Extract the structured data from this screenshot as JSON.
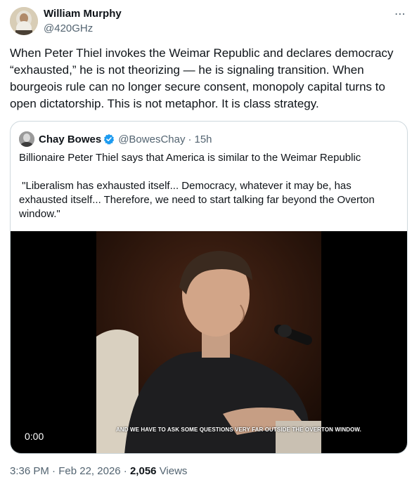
{
  "author": {
    "name": "William Murphy",
    "handle": "@420GHz"
  },
  "more_icon": "⋯",
  "tweet": {
    "text": "When Peter Thiel invokes the Weimar Republic and declares democracy “exhausted,” he is not theorizing — he is signaling transition. When bourgeois rule can no longer secure consent, monopoly capital turns to open dictatorship. This is not metaphor. It is class strategy."
  },
  "quote": {
    "name": "Chay Bowes",
    "handle": "@BowesChay",
    "separator": "·",
    "time": "15h",
    "verified_icon": "verified-badge-icon",
    "text": "Billionaire Peter Thiel says that America is similar to the Weimar Republic\n\n \"Liberalism has exhausted itself... Democracy, whatever it may be, has exhausted itself... Therefore, we need to start talking far beyond the Overton window.\"",
    "video": {
      "timecode": "0:00",
      "subtitle": "AND WE HAVE TO ASK SOME QUESTIONS VERY FAR OUTSIDE THE OVERTON WINDOW."
    }
  },
  "footer": {
    "time": "3:36 PM",
    "sep1": "·",
    "date": "Feb 22, 2026",
    "sep2": "·",
    "views_count": "2,056",
    "views_label": "Views"
  },
  "colors": {
    "text": "#0f1419",
    "secondary": "#536471",
    "border": "#cfd9de",
    "verified": "#1d9bf0"
  }
}
